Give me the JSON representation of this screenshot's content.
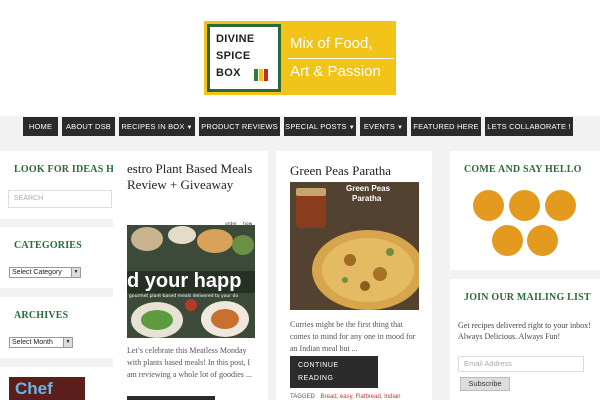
{
  "logo": {
    "words": [
      "DIVINE",
      "SPICE",
      "BOX"
    ],
    "tagline_line1": "Mix of Food,",
    "tagline_line2": "Art & Passion",
    "colors": {
      "background": "#f2c318",
      "border": "#2c6a38"
    }
  },
  "nav": {
    "items": [
      {
        "label": "HOME",
        "has_dropdown": false
      },
      {
        "label": "ABOUT DSB",
        "has_dropdown": false
      },
      {
        "label": "RECIPES IN BOX",
        "has_dropdown": true
      },
      {
        "label": "PRODUCT REVIEWS",
        "has_dropdown": false
      },
      {
        "label": "SPECIAL POSTS",
        "has_dropdown": true
      },
      {
        "label": "EVENTS",
        "has_dropdown": true
      },
      {
        "label": "FEATURED HERE",
        "has_dropdown": false
      },
      {
        "label": "LETS COLLABORATE !",
        "has_dropdown": false
      }
    ]
  },
  "left_sidebar": {
    "ideas_title": "LOOK FOR IDEAS HERE",
    "search_placeholder": "SEARCH",
    "categories_title": "CATEGORIES",
    "categories_select": "Select Category",
    "archives_title": "ARCHIVES",
    "archives_select": "Select Month",
    "chef_badge": "Chef"
  },
  "posts": [
    {
      "title": "estro Plant Based Meals Review + Giveaway",
      "image_text": "d your happ",
      "image_subtext": "gourmet plant-based meals delivered to your do",
      "image_top_labels": [
        "order",
        "how it"
      ],
      "excerpt": "Let’s celebrate this Meatless Monday with plants based meals! In this post, I am reviewing a whole lot of goodies ..."
    },
    {
      "title": "Green Peas Paratha",
      "image_text_line1": "Green Peas",
      "image_text_line2": "Paratha",
      "excerpt": "Curries might be the first thing that comes to mind for any one in mood for an Indian meal but ...",
      "continue_label": "CONTINUE READING",
      "tagged_label": "TAGGED",
      "tags": "Bread, easy, Flatbread, Indian"
    }
  ],
  "right_sidebar": {
    "social_title": "COME AND SAY HELLO",
    "social_icons": [
      "social-icon-1",
      "social-icon-2",
      "social-icon-3",
      "social-icon-4",
      "social-icon-5"
    ],
    "mailing_title": "JOIN OUR MAILING LIST",
    "mailing_text": "Get recipes delivered right to your inbox!",
    "mailing_text2": "Always Delicious. Always Fun!",
    "email_placeholder": "Email Address",
    "subscribe_label": "Subscribe",
    "accent_color": "#e39a1f"
  }
}
